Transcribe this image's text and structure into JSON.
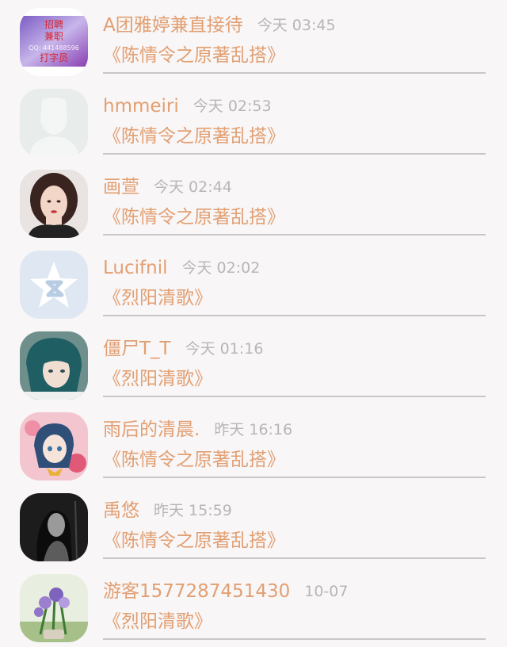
{
  "comments": [
    {
      "name": "A团雅婷兼直接待",
      "time": "今天 03:45",
      "post": "《陈情令之原著乱搭》",
      "avatar_text": [
        "招聘",
        "兼职",
        "QQ: 441488596",
        "打字员"
      ]
    },
    {
      "name": "hmmeiri",
      "time": "今天 02:53",
      "post": "《陈情令之原著乱搭》"
    },
    {
      "name": "画萱",
      "time": "今天 02:44",
      "post": "《陈情令之原著乱搭》"
    },
    {
      "name": "Lucifnil",
      "time": "今天 02:02",
      "post": "《烈阳清歌》"
    },
    {
      "name": "僵尸T_T",
      "time": "今天 01:16",
      "post": "《烈阳清歌》"
    },
    {
      "name": "雨后的清晨.",
      "time": "昨天 16:16",
      "post": "《陈情令之原著乱搭》"
    },
    {
      "name": "禹悠",
      "time": "昨天 15:59",
      "post": "《陈情令之原著乱搭》"
    },
    {
      "name": "游客1577287451430",
      "time": "10-07",
      "post": "《烈阳清歌》"
    }
  ],
  "colors": {
    "accent": "#e29f72",
    "muted": "#b8b5b5",
    "background": "#f8f6f7",
    "divider": "#c8c6c7"
  }
}
